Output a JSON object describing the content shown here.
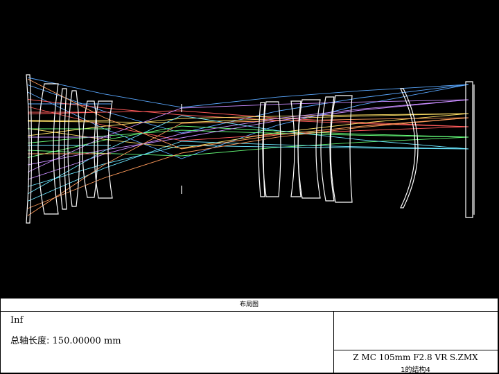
{
  "panel": {
    "title": "布局图",
    "field": "Inf",
    "total_length_label": "总轴长度:",
    "total_length_value": "150.00000 mm",
    "file_name": "Z MC 105mm F2.8 VR S.ZMX",
    "config_label": "1的结构4"
  },
  "colors": {
    "background": "#000000",
    "lens": "#ffffff",
    "ray_fields": [
      "#5aa8ff",
      "#ff5a5a",
      "#ffe066",
      "#66ff7a",
      "#c88cff",
      "#6ae6ff",
      "#ff9a5a"
    ]
  }
}
